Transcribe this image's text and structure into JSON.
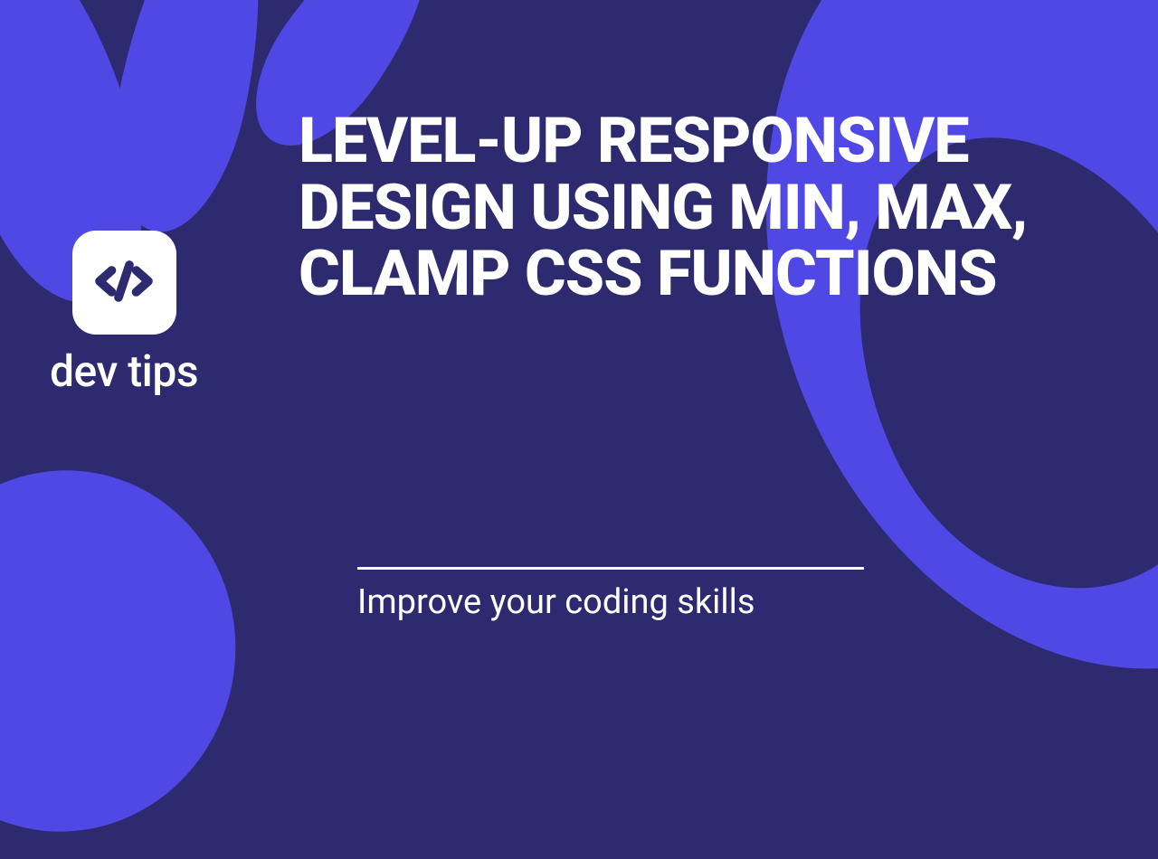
{
  "logo": {
    "text": "dev tips",
    "icon_name": "code-slash-icon"
  },
  "headline": "LEVEL-UP RESPONSIVE DESIGN USING MIN, MAX, CLAMP CSS FUNCTIONS",
  "tagline": "Improve your coding skills",
  "colors": {
    "background": "#2d2a70",
    "accent": "#5048e5",
    "text": "#ffffff"
  }
}
